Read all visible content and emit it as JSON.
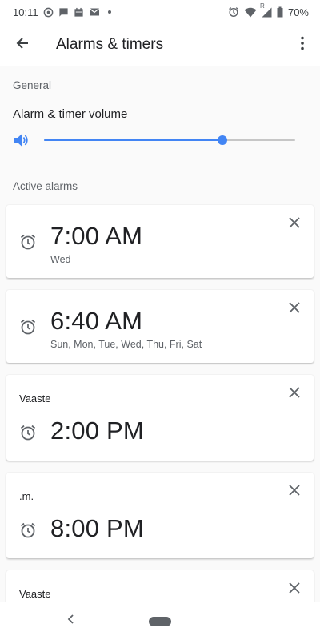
{
  "status_bar": {
    "time": "10:11",
    "battery": "70%",
    "signal_marker": "R",
    "icons_left": [
      "whatsapp-icon",
      "chat-icon",
      "calendar-icon",
      "mail-icon",
      "dot-icon"
    ],
    "icons_right": [
      "alarm-icon",
      "wifi-icon",
      "signal-icon",
      "battery-icon"
    ]
  },
  "app_bar": {
    "title": "Alarms & timers"
  },
  "general": {
    "header": "General",
    "volume_label": "Alarm & timer volume",
    "volume_level": 0.71,
    "accent_color": "#4285f4"
  },
  "active_alarms": {
    "header": "Active alarms",
    "alarms": [
      {
        "label": "",
        "time": "7:00 AM",
        "days": "Wed"
      },
      {
        "label": "",
        "time": "6:40 AM",
        "days": "Sun, Mon, Tue, Wed, Thu, Fri, Sat"
      },
      {
        "label": "Vaaste",
        "time": "2:00 PM",
        "days": ""
      },
      {
        "label": ".m.",
        "time": "8:00 PM",
        "days": ""
      },
      {
        "label": "Vaaste",
        "time": "",
        "days": ""
      }
    ]
  }
}
